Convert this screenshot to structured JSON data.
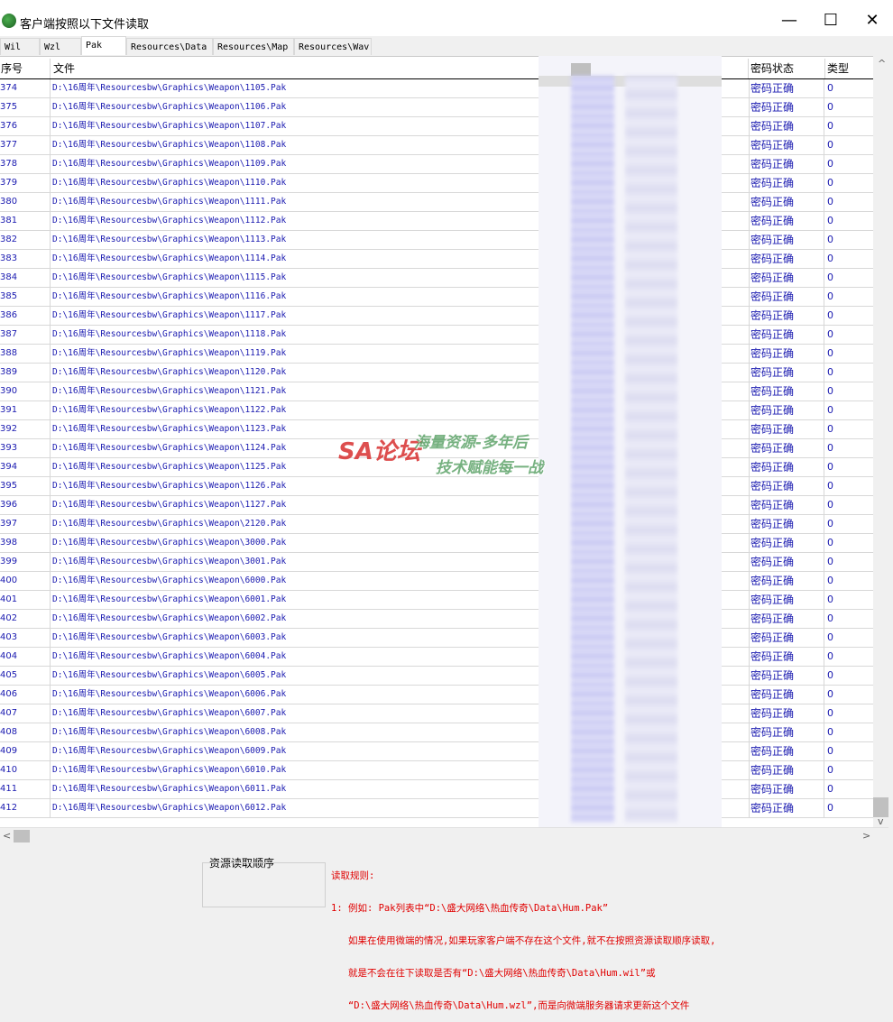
{
  "window": {
    "title": "客户端按照以下文件读取",
    "minimize_glyph": "—",
    "maximize_glyph": "☐",
    "close_glyph": "✕"
  },
  "tabs": [
    "Wil",
    "Wzl",
    "Pak",
    "Resources\\Data",
    "Resources\\Map",
    "Resources\\Wav"
  ],
  "active_tab": "Pak",
  "columns": {
    "num": "序号",
    "file": "文件",
    "status": "密码状态",
    "type": "类型"
  },
  "rows": [
    {
      "num": "374",
      "file": "D:\\16周年\\Resourcesbw\\Graphics\\Weapon\\1105.Pak",
      "status": "密码正确",
      "type": "0"
    },
    {
      "num": "375",
      "file": "D:\\16周年\\Resourcesbw\\Graphics\\Weapon\\1106.Pak",
      "status": "密码正确",
      "type": "0"
    },
    {
      "num": "376",
      "file": "D:\\16周年\\Resourcesbw\\Graphics\\Weapon\\1107.Pak",
      "status": "密码正确",
      "type": "0"
    },
    {
      "num": "377",
      "file": "D:\\16周年\\Resourcesbw\\Graphics\\Weapon\\1108.Pak",
      "status": "密码正确",
      "type": "0"
    },
    {
      "num": "378",
      "file": "D:\\16周年\\Resourcesbw\\Graphics\\Weapon\\1109.Pak",
      "status": "密码正确",
      "type": "0"
    },
    {
      "num": "379",
      "file": "D:\\16周年\\Resourcesbw\\Graphics\\Weapon\\1110.Pak",
      "status": "密码正确",
      "type": "0"
    },
    {
      "num": "380",
      "file": "D:\\16周年\\Resourcesbw\\Graphics\\Weapon\\1111.Pak",
      "status": "密码正确",
      "type": "0"
    },
    {
      "num": "381",
      "file": "D:\\16周年\\Resourcesbw\\Graphics\\Weapon\\1112.Pak",
      "status": "密码正确",
      "type": "0"
    },
    {
      "num": "382",
      "file": "D:\\16周年\\Resourcesbw\\Graphics\\Weapon\\1113.Pak",
      "status": "密码正确",
      "type": "0"
    },
    {
      "num": "383",
      "file": "D:\\16周年\\Resourcesbw\\Graphics\\Weapon\\1114.Pak",
      "status": "密码正确",
      "type": "0"
    },
    {
      "num": "384",
      "file": "D:\\16周年\\Resourcesbw\\Graphics\\Weapon\\1115.Pak",
      "status": "密码正确",
      "type": "0"
    },
    {
      "num": "385",
      "file": "D:\\16周年\\Resourcesbw\\Graphics\\Weapon\\1116.Pak",
      "status": "密码正确",
      "type": "0"
    },
    {
      "num": "386",
      "file": "D:\\16周年\\Resourcesbw\\Graphics\\Weapon\\1117.Pak",
      "status": "密码正确",
      "type": "0"
    },
    {
      "num": "387",
      "file": "D:\\16周年\\Resourcesbw\\Graphics\\Weapon\\1118.Pak",
      "status": "密码正确",
      "type": "0"
    },
    {
      "num": "388",
      "file": "D:\\16周年\\Resourcesbw\\Graphics\\Weapon\\1119.Pak",
      "status": "密码正确",
      "type": "0"
    },
    {
      "num": "389",
      "file": "D:\\16周年\\Resourcesbw\\Graphics\\Weapon\\1120.Pak",
      "status": "密码正确",
      "type": "0"
    },
    {
      "num": "390",
      "file": "D:\\16周年\\Resourcesbw\\Graphics\\Weapon\\1121.Pak",
      "status": "密码正确",
      "type": "0"
    },
    {
      "num": "391",
      "file": "D:\\16周年\\Resourcesbw\\Graphics\\Weapon\\1122.Pak",
      "status": "密码正确",
      "type": "0"
    },
    {
      "num": "392",
      "file": "D:\\16周年\\Resourcesbw\\Graphics\\Weapon\\1123.Pak",
      "status": "密码正确",
      "type": "0"
    },
    {
      "num": "393",
      "file": "D:\\16周年\\Resourcesbw\\Graphics\\Weapon\\1124.Pak",
      "status": "密码正确",
      "type": "0"
    },
    {
      "num": "394",
      "file": "D:\\16周年\\Resourcesbw\\Graphics\\Weapon\\1125.Pak",
      "status": "密码正确",
      "type": "0"
    },
    {
      "num": "395",
      "file": "D:\\16周年\\Resourcesbw\\Graphics\\Weapon\\1126.Pak",
      "status": "密码正确",
      "type": "0"
    },
    {
      "num": "396",
      "file": "D:\\16周年\\Resourcesbw\\Graphics\\Weapon\\1127.Pak",
      "status": "密码正确",
      "type": "0"
    },
    {
      "num": "397",
      "file": "D:\\16周年\\Resourcesbw\\Graphics\\Weapon\\2120.Pak",
      "status": "密码正确",
      "type": "0"
    },
    {
      "num": "398",
      "file": "D:\\16周年\\Resourcesbw\\Graphics\\Weapon\\3000.Pak",
      "status": "密码正确",
      "type": "0"
    },
    {
      "num": "399",
      "file": "D:\\16周年\\Resourcesbw\\Graphics\\Weapon\\3001.Pak",
      "status": "密码正确",
      "type": "0"
    },
    {
      "num": "400",
      "file": "D:\\16周年\\Resourcesbw\\Graphics\\Weapon\\6000.Pak",
      "status": "密码正确",
      "type": "0"
    },
    {
      "num": "401",
      "file": "D:\\16周年\\Resourcesbw\\Graphics\\Weapon\\6001.Pak",
      "status": "密码正确",
      "type": "0"
    },
    {
      "num": "402",
      "file": "D:\\16周年\\Resourcesbw\\Graphics\\Weapon\\6002.Pak",
      "status": "密码正确",
      "type": "0"
    },
    {
      "num": "403",
      "file": "D:\\16周年\\Resourcesbw\\Graphics\\Weapon\\6003.Pak",
      "status": "密码正确",
      "type": "0"
    },
    {
      "num": "404",
      "file": "D:\\16周年\\Resourcesbw\\Graphics\\Weapon\\6004.Pak",
      "status": "密码正确",
      "type": "0"
    },
    {
      "num": "405",
      "file": "D:\\16周年\\Resourcesbw\\Graphics\\Weapon\\6005.Pak",
      "status": "密码正确",
      "type": "0"
    },
    {
      "num": "406",
      "file": "D:\\16周年\\Resourcesbw\\Graphics\\Weapon\\6006.Pak",
      "status": "密码正确",
      "type": "0"
    },
    {
      "num": "407",
      "file": "D:\\16周年\\Resourcesbw\\Graphics\\Weapon\\6007.Pak",
      "status": "密码正确",
      "type": "0"
    },
    {
      "num": "408",
      "file": "D:\\16周年\\Resourcesbw\\Graphics\\Weapon\\6008.Pak",
      "status": "密码正确",
      "type": "0"
    },
    {
      "num": "409",
      "file": "D:\\16周年\\Resourcesbw\\Graphics\\Weapon\\6009.Pak",
      "status": "密码正确",
      "type": "0"
    },
    {
      "num": "410",
      "file": "D:\\16周年\\Resourcesbw\\Graphics\\Weapon\\6010.Pak",
      "status": "密码正确",
      "type": "0"
    },
    {
      "num": "411",
      "file": "D:\\16周年\\Resourcesbw\\Graphics\\Weapon\\6011.Pak",
      "status": "密码正确",
      "type": "0"
    },
    {
      "num": "412",
      "file": "D:\\16周年\\Resourcesbw\\Graphics\\Weapon\\6012.Pak",
      "status": "密码正确",
      "type": "0"
    }
  ],
  "footer": {
    "order_label": "资源读取顺序",
    "rules": [
      "读取规则:",
      "1: 例如: Pak列表中“D:\\盛大网络\\热血传奇\\Data\\Hum.Pak”",
      "   如果在使用微端的情况,如果玩家客户端不存在这个文件,就不在按照资源读取顺序读取,",
      "   就是不会在往下读取是否有“D:\\盛大网络\\热血传奇\\Data\\Hum.wil”或",
      "   “D:\\盛大网络\\热血传奇\\Data\\Hum.wzl”,而是向微端服务器请求更新这个文件"
    ]
  },
  "watermark": {
    "logo_text": "SA论坛",
    "line1": "海量资源-多年后",
    "line2": "技术赋能每一战"
  },
  "scroll": {
    "left_arrow": "<",
    "right_arrow": ">",
    "up_arrow": "^",
    "down_arrow": "v"
  },
  "colors": {
    "text_blue": "#1a1ab0",
    "rules_red": "#e00000"
  }
}
